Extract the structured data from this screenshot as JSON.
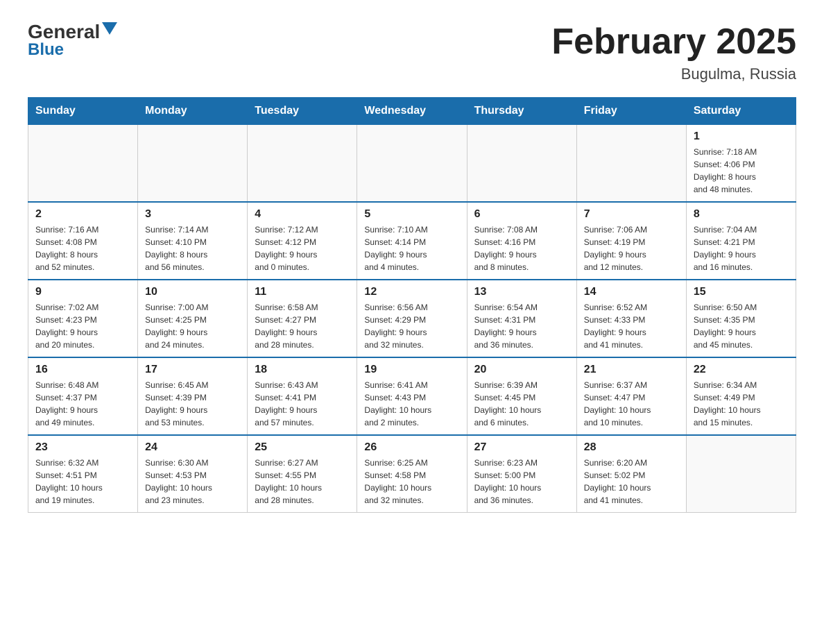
{
  "header": {
    "logo_top": "General",
    "logo_bottom": "Blue",
    "title": "February 2025",
    "subtitle": "Bugulma, Russia"
  },
  "days_of_week": [
    "Sunday",
    "Monday",
    "Tuesday",
    "Wednesday",
    "Thursday",
    "Friday",
    "Saturday"
  ],
  "weeks": [
    {
      "days": [
        {
          "number": "",
          "info": "",
          "empty": true
        },
        {
          "number": "",
          "info": "",
          "empty": true
        },
        {
          "number": "",
          "info": "",
          "empty": true
        },
        {
          "number": "",
          "info": "",
          "empty": true
        },
        {
          "number": "",
          "info": "",
          "empty": true
        },
        {
          "number": "",
          "info": "",
          "empty": true
        },
        {
          "number": "1",
          "info": "Sunrise: 7:18 AM\nSunset: 4:06 PM\nDaylight: 8 hours\nand 48 minutes.",
          "empty": false
        }
      ]
    },
    {
      "days": [
        {
          "number": "2",
          "info": "Sunrise: 7:16 AM\nSunset: 4:08 PM\nDaylight: 8 hours\nand 52 minutes.",
          "empty": false
        },
        {
          "number": "3",
          "info": "Sunrise: 7:14 AM\nSunset: 4:10 PM\nDaylight: 8 hours\nand 56 minutes.",
          "empty": false
        },
        {
          "number": "4",
          "info": "Sunrise: 7:12 AM\nSunset: 4:12 PM\nDaylight: 9 hours\nand 0 minutes.",
          "empty": false
        },
        {
          "number": "5",
          "info": "Sunrise: 7:10 AM\nSunset: 4:14 PM\nDaylight: 9 hours\nand 4 minutes.",
          "empty": false
        },
        {
          "number": "6",
          "info": "Sunrise: 7:08 AM\nSunset: 4:16 PM\nDaylight: 9 hours\nand 8 minutes.",
          "empty": false
        },
        {
          "number": "7",
          "info": "Sunrise: 7:06 AM\nSunset: 4:19 PM\nDaylight: 9 hours\nand 12 minutes.",
          "empty": false
        },
        {
          "number": "8",
          "info": "Sunrise: 7:04 AM\nSunset: 4:21 PM\nDaylight: 9 hours\nand 16 minutes.",
          "empty": false
        }
      ]
    },
    {
      "days": [
        {
          "number": "9",
          "info": "Sunrise: 7:02 AM\nSunset: 4:23 PM\nDaylight: 9 hours\nand 20 minutes.",
          "empty": false
        },
        {
          "number": "10",
          "info": "Sunrise: 7:00 AM\nSunset: 4:25 PM\nDaylight: 9 hours\nand 24 minutes.",
          "empty": false
        },
        {
          "number": "11",
          "info": "Sunrise: 6:58 AM\nSunset: 4:27 PM\nDaylight: 9 hours\nand 28 minutes.",
          "empty": false
        },
        {
          "number": "12",
          "info": "Sunrise: 6:56 AM\nSunset: 4:29 PM\nDaylight: 9 hours\nand 32 minutes.",
          "empty": false
        },
        {
          "number": "13",
          "info": "Sunrise: 6:54 AM\nSunset: 4:31 PM\nDaylight: 9 hours\nand 36 minutes.",
          "empty": false
        },
        {
          "number": "14",
          "info": "Sunrise: 6:52 AM\nSunset: 4:33 PM\nDaylight: 9 hours\nand 41 minutes.",
          "empty": false
        },
        {
          "number": "15",
          "info": "Sunrise: 6:50 AM\nSunset: 4:35 PM\nDaylight: 9 hours\nand 45 minutes.",
          "empty": false
        }
      ]
    },
    {
      "days": [
        {
          "number": "16",
          "info": "Sunrise: 6:48 AM\nSunset: 4:37 PM\nDaylight: 9 hours\nand 49 minutes.",
          "empty": false
        },
        {
          "number": "17",
          "info": "Sunrise: 6:45 AM\nSunset: 4:39 PM\nDaylight: 9 hours\nand 53 minutes.",
          "empty": false
        },
        {
          "number": "18",
          "info": "Sunrise: 6:43 AM\nSunset: 4:41 PM\nDaylight: 9 hours\nand 57 minutes.",
          "empty": false
        },
        {
          "number": "19",
          "info": "Sunrise: 6:41 AM\nSunset: 4:43 PM\nDaylight: 10 hours\nand 2 minutes.",
          "empty": false
        },
        {
          "number": "20",
          "info": "Sunrise: 6:39 AM\nSunset: 4:45 PM\nDaylight: 10 hours\nand 6 minutes.",
          "empty": false
        },
        {
          "number": "21",
          "info": "Sunrise: 6:37 AM\nSunset: 4:47 PM\nDaylight: 10 hours\nand 10 minutes.",
          "empty": false
        },
        {
          "number": "22",
          "info": "Sunrise: 6:34 AM\nSunset: 4:49 PM\nDaylight: 10 hours\nand 15 minutes.",
          "empty": false
        }
      ]
    },
    {
      "days": [
        {
          "number": "23",
          "info": "Sunrise: 6:32 AM\nSunset: 4:51 PM\nDaylight: 10 hours\nand 19 minutes.",
          "empty": false
        },
        {
          "number": "24",
          "info": "Sunrise: 6:30 AM\nSunset: 4:53 PM\nDaylight: 10 hours\nand 23 minutes.",
          "empty": false
        },
        {
          "number": "25",
          "info": "Sunrise: 6:27 AM\nSunset: 4:55 PM\nDaylight: 10 hours\nand 28 minutes.",
          "empty": false
        },
        {
          "number": "26",
          "info": "Sunrise: 6:25 AM\nSunset: 4:58 PM\nDaylight: 10 hours\nand 32 minutes.",
          "empty": false
        },
        {
          "number": "27",
          "info": "Sunrise: 6:23 AM\nSunset: 5:00 PM\nDaylight: 10 hours\nand 36 minutes.",
          "empty": false
        },
        {
          "number": "28",
          "info": "Sunrise: 6:20 AM\nSunset: 5:02 PM\nDaylight: 10 hours\nand 41 minutes.",
          "empty": false
        },
        {
          "number": "",
          "info": "",
          "empty": true
        }
      ]
    }
  ]
}
